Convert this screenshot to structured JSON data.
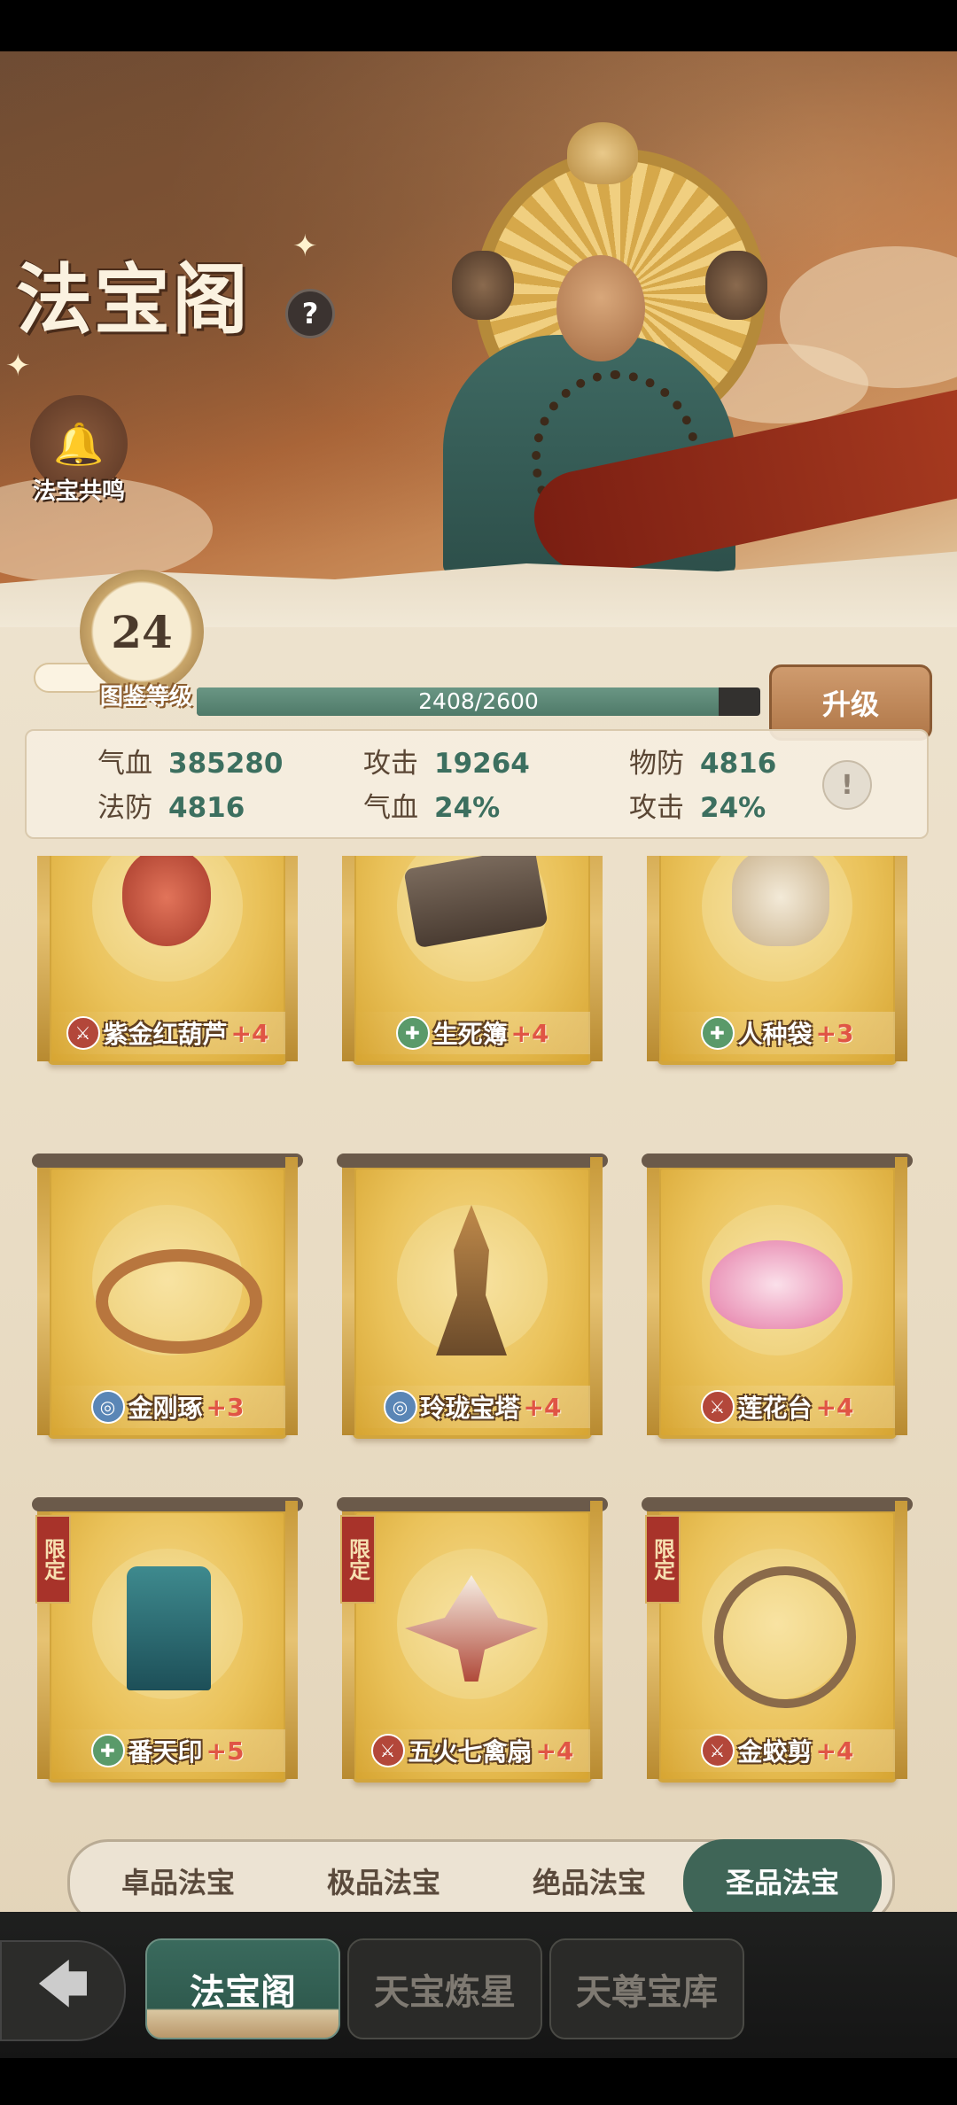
{
  "header": {
    "title": "法宝阁",
    "help_label": "?",
    "resonance_label": "法宝共鸣"
  },
  "level": {
    "value": "24",
    "label": "图鉴等级",
    "progress_text": "2408/2600",
    "progress_current": 2408,
    "progress_max": 2600,
    "upgrade_label": "升级"
  },
  "stats": [
    {
      "label": "气血",
      "value": "385280"
    },
    {
      "label": "攻击",
      "value": "19264"
    },
    {
      "label": "物防",
      "value": "4816"
    },
    {
      "label": "法防",
      "value": "4816"
    },
    {
      "label": "气血",
      "value": "24%"
    },
    {
      "label": "攻击",
      "value": "24%"
    }
  ],
  "stats_info_label": "!",
  "items": [
    {
      "name": "紫金红葫芦",
      "plus": "+4",
      "type": "attack",
      "icon": "gourd-icon",
      "limited": ""
    },
    {
      "name": "生死簿",
      "plus": "+4",
      "type": "heal",
      "icon": "book-icon",
      "limited": ""
    },
    {
      "name": "人种袋",
      "plus": "+3",
      "type": "heal",
      "icon": "bag-icon",
      "limited": ""
    },
    {
      "name": "金刚琢",
      "plus": "+3",
      "type": "control",
      "icon": "bracelet-icon",
      "limited": ""
    },
    {
      "name": "玲珑宝塔",
      "plus": "+4",
      "type": "control",
      "icon": "pagoda-icon",
      "limited": ""
    },
    {
      "name": "莲花台",
      "plus": "+4",
      "type": "attack",
      "icon": "lotus-icon",
      "limited": ""
    },
    {
      "name": "番天印",
      "plus": "+5",
      "type": "heal",
      "icon": "seal-icon",
      "limited": "限定"
    },
    {
      "name": "五火七禽扇",
      "plus": "+4",
      "type": "attack",
      "icon": "fan-icon",
      "limited": "限定"
    },
    {
      "name": "金蛟剪",
      "plus": "+4",
      "type": "attack",
      "icon": "scissors-icon",
      "limited": "限定"
    }
  ],
  "tiers": [
    "卓品法宝",
    "极品法宝",
    "绝品法宝",
    "圣品法宝"
  ],
  "tiers_active": "圣品法宝",
  "nav": {
    "back_label": "🡄",
    "tabs": [
      "法宝阁",
      "天宝炼星",
      "天尊宝库"
    ],
    "active": "法宝阁"
  },
  "colors": {
    "accent_green": "#3f6557",
    "gold": "#eac25a",
    "plus_red": "#e05545"
  }
}
